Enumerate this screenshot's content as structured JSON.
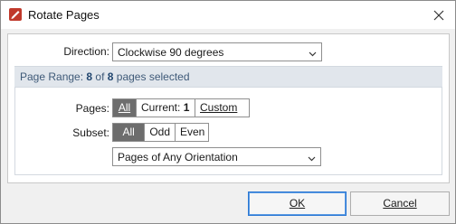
{
  "window": {
    "title": "Rotate Pages",
    "icon": "pdf-editor-app-icon",
    "accent": "#c0392b"
  },
  "direction": {
    "label": "Direction:",
    "value": "Clockwise 90 degrees"
  },
  "page_range": {
    "prefix": "Page Range: ",
    "selected": "8",
    "middle": " of ",
    "total": "8",
    "suffix": " pages selected"
  },
  "pages": {
    "label": "Pages:",
    "options": [
      "All",
      "Current: ",
      "Custom"
    ],
    "current_number": "1",
    "selected": "All"
  },
  "subset": {
    "label": "Subset:",
    "options": [
      "All",
      "Odd",
      "Even"
    ],
    "selected": "All"
  },
  "orientation": {
    "value": "Pages of Any Orientation"
  },
  "buttons": {
    "ok": "OK",
    "cancel": "Cancel"
  }
}
